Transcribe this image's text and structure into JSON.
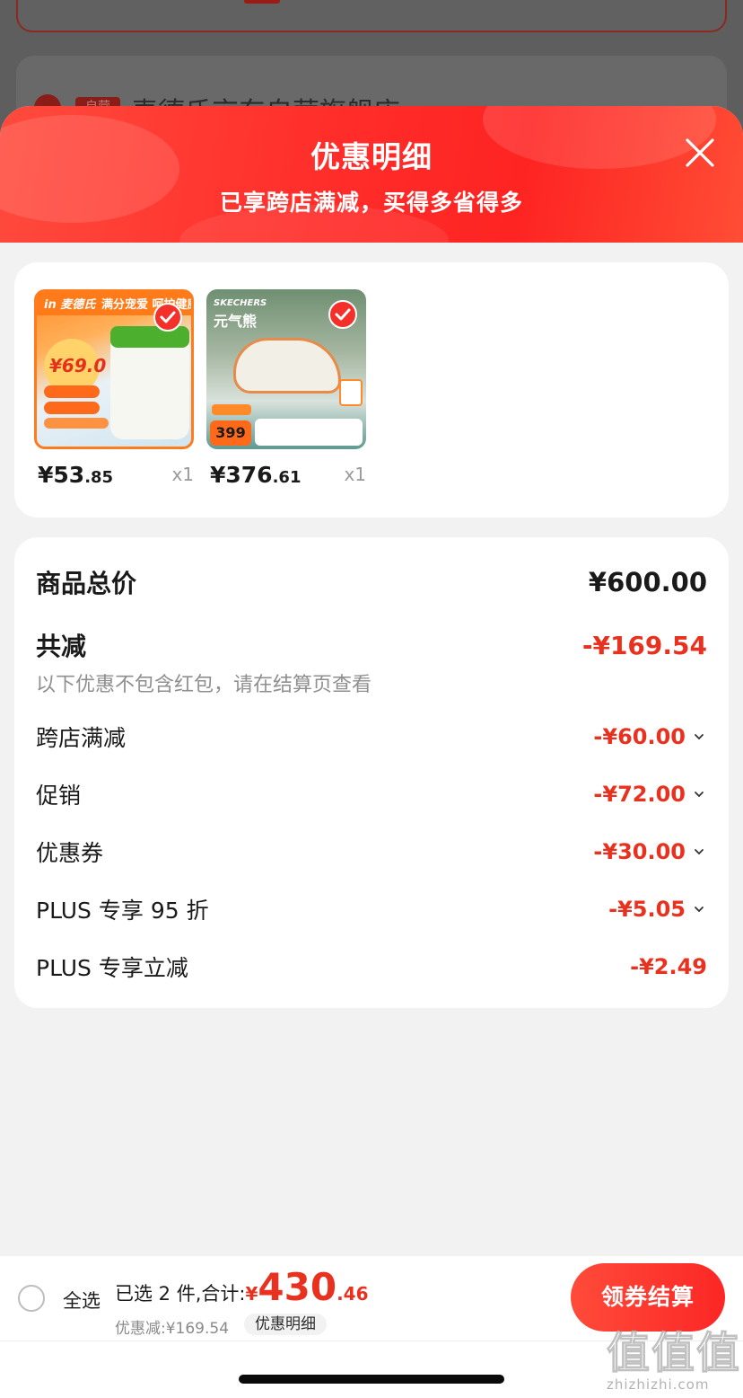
{
  "background": {
    "store_tag": "自营",
    "store_name": "麦德氏京东自营旗舰店 ›"
  },
  "sheet": {
    "title": "优惠明细",
    "subtitle": "已享跨店满减，买得多省得多"
  },
  "products": [
    {
      "price_int": "¥53",
      "price_dec": ".85",
      "qty": "x1",
      "thumb_logo": "in 麦德氏",
      "thumb_banner": "满分宠爱 呵护健康",
      "thumb_price": "¥69.0"
    },
    {
      "price_int": "¥376",
      "price_dec": ".61",
      "qty": "x1",
      "thumb_brand": "SKECHERS",
      "thumb_title": "元气熊",
      "thumb_price": "399"
    }
  ],
  "summary": {
    "total_label": "商品总价",
    "total_value": "¥600.00",
    "discount_label": "共减",
    "discount_value": "-¥169.54",
    "note": "以下优惠不包含红包，请在结算页查看",
    "items": [
      {
        "label": "跨店满减",
        "value": "-¥60.00",
        "expandable": true
      },
      {
        "label": "促销",
        "value": "-¥72.00",
        "expandable": true
      },
      {
        "label": "优惠券",
        "value": "-¥30.00",
        "expandable": true
      },
      {
        "label": "PLUS 专享 95 折",
        "value": "-¥5.05",
        "expandable": true
      },
      {
        "label": "PLUS 专享立减",
        "value": "-¥2.49",
        "expandable": false
      }
    ]
  },
  "bottom_bar": {
    "select_all": "全选",
    "selected_text": "已选 2 件,合计:",
    "yen": "¥",
    "amount_int": "430",
    "amount_dec": ".46",
    "discount_line": "优惠减:¥169.54",
    "detail_chip": "优惠明细",
    "checkout": "领券结算"
  },
  "watermark": {
    "glyphs": "值值值",
    "url": "zhizhizhi.com"
  },
  "colors": {
    "accent_red": "#e8321f",
    "header_red": "#fe2422"
  }
}
